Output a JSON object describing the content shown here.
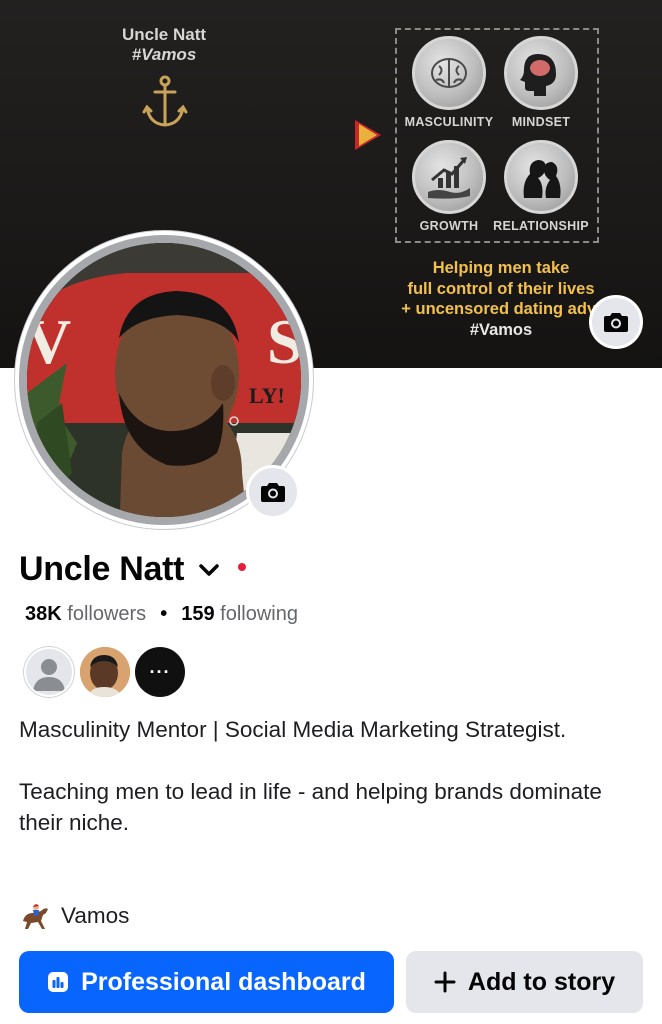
{
  "cover": {
    "brand_name": "Uncle Natt",
    "brand_hashtag": "#Vamos",
    "pillars": [
      {
        "label": "MASCULINITY",
        "icon": "brain-icon"
      },
      {
        "label": "MINDSET",
        "icon": "head-brain-icon"
      },
      {
        "label": "GROWTH",
        "icon": "growth-chart-icon"
      },
      {
        "label": "RELATIONSHIP",
        "icon": "couple-icon"
      }
    ],
    "tagline_lines": [
      "Helping men take",
      "full control of their lives",
      "+ uncensored dating advi"
    ],
    "tagline_hashtag": "#Vamos",
    "camera_icon": "camera-icon"
  },
  "profile": {
    "name": "Uncle Natt",
    "followers_count": "38K",
    "followers_label": "followers",
    "following_count": "159",
    "following_label": "following",
    "mutual_more": "···"
  },
  "bio": {
    "line1": "Masculinity Mentor | Social Media Marketing Strategist.",
    "line2": "Teaching men to lead in life - and helping brands dominate their niche.",
    "link_emoji_icon": "horse-racing-icon",
    "link_text": "Vamos"
  },
  "actions": {
    "primary_label": "Professional dashboard",
    "secondary_label": "Add to story"
  },
  "colors": {
    "primary_blue": "#0866ff",
    "secondary_gray": "#e4e6eb",
    "tagline_gold": "#f2c14b",
    "live_dot": "#e41e3f"
  }
}
